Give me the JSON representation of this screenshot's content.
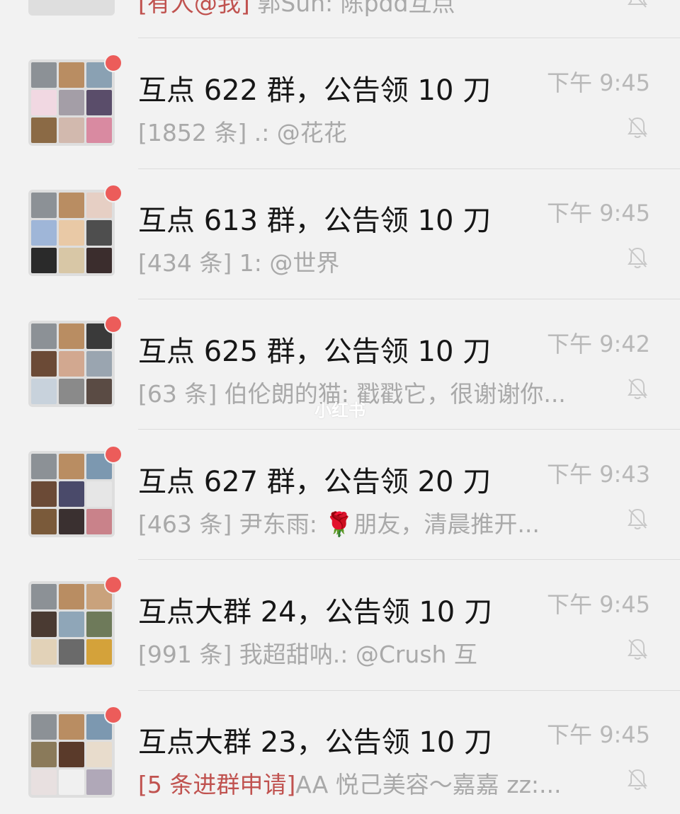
{
  "top_partial": {
    "preview_tag": "[有人@我]",
    "preview_text": "郭Sun: 陈pdd互点"
  },
  "chats": [
    {
      "title": "互点 622 群，公告领 10 刀",
      "time": "下午 9:45",
      "preview_tag": "",
      "preview": "[1852 条] .: @花花"
    },
    {
      "title": "互点 613 群，公告领 10 刀",
      "time": "下午 9:45",
      "preview_tag": "",
      "preview": "[434 条] 1: @世界"
    },
    {
      "title": "互点 625 群，公告领 10 刀",
      "time": "下午 9:42",
      "preview_tag": "",
      "preview": "[63 条] 伯伦朗的猫: 戳戳它，很谢谢你..."
    },
    {
      "title": "互点 627 群，公告领 20 刀",
      "time": "下午 9:43",
      "preview_tag": "",
      "preview": "[463 条] 尹东雨: 🌹朋友，清晨推开..."
    },
    {
      "title": "互点大群 24，公告领 10 刀",
      "time": "下午 9:45",
      "preview_tag": "",
      "preview": "[991 条] 我超甜呐.: @Crush 互"
    },
    {
      "title": "互点大群 23，公告领 10 刀",
      "time": "下午 9:45",
      "preview_tag": "[5 条进群申请]",
      "preview": "AA 悦己美容～嘉嘉 zz:..."
    }
  ],
  "watermark": "小红书",
  "icons": {
    "mute": "bell-off-icon",
    "unread": "unread-dot"
  },
  "colors": {
    "unread_dot": "#ec5c5a",
    "mention_tag": "#c0524f",
    "muted_text": "#a9a9a9"
  }
}
